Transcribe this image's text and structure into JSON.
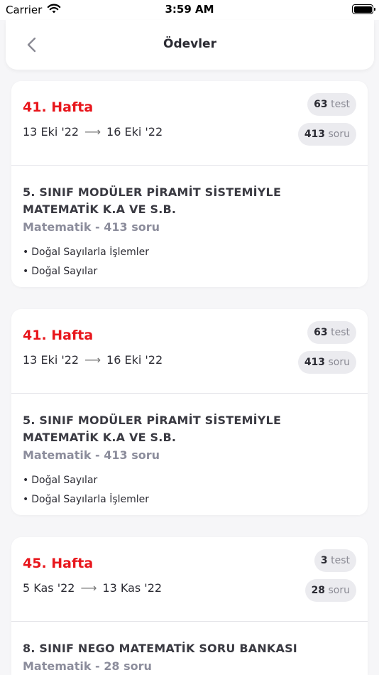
{
  "status_bar": {
    "carrier": "Carrier",
    "time": "3:59 AM"
  },
  "header": {
    "title": "Ödevler"
  },
  "assignments": [
    {
      "week": "41. Hafta",
      "start": "13 Eki '22",
      "end": "16 Eki '22",
      "arrow": "⟶",
      "test_count": "63",
      "test_unit": "test",
      "question_count": "413",
      "question_unit": "soru",
      "book": "5. SINIF MODÜLER PİRAMİT SİSTEMİYLE MATEMATİK K.A VE S.B.",
      "subject": "Matematik - 413 soru",
      "topics": [
        "Doğal Sayılarla İşlemler",
        "Doğal Sayılar"
      ]
    },
    {
      "week": "41. Hafta",
      "start": "13 Eki '22",
      "end": "16 Eki '22",
      "arrow": "⟶",
      "test_count": "63",
      "test_unit": "test",
      "question_count": "413",
      "question_unit": "soru",
      "book": "5. SINIF MODÜLER PİRAMİT SİSTEMİYLE MATEMATİK K.A VE S.B.",
      "subject": "Matematik - 413 soru",
      "topics": [
        "Doğal Sayılar",
        "Doğal Sayılarla İşlemler"
      ]
    },
    {
      "week": "45. Hafta",
      "start": "5 Kas '22",
      "end": "13 Kas '22",
      "arrow": "⟶",
      "test_count": "3",
      "test_unit": "test",
      "question_count": "28",
      "question_unit": "soru",
      "book": "8. SINIF NEGO MATEMATİK SORU BANKASI",
      "subject": "Matematik - 28 soru",
      "topics": []
    }
  ],
  "colors": {
    "accent": "#e8161c",
    "muted": "#8c8d9c",
    "pill_bg": "#ebebef",
    "background": "#f6f6f8"
  },
  "icons": {
    "back": "chevron-left-icon",
    "wifi": "wifi-icon",
    "battery": "battery-icon"
  }
}
